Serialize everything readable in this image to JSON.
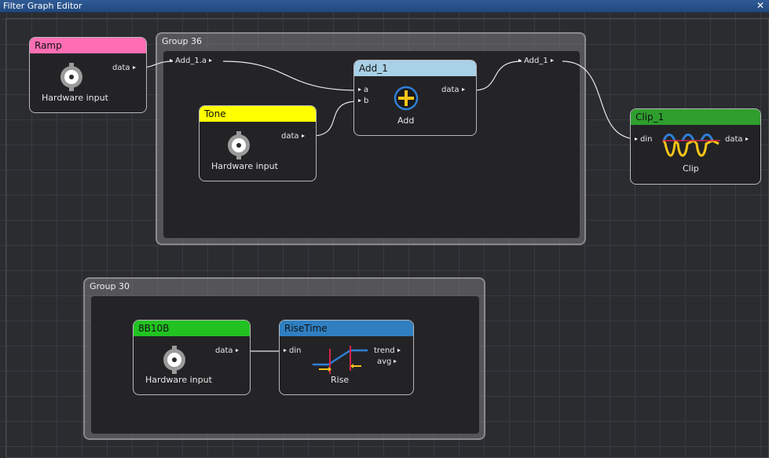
{
  "window": {
    "title": "Filter Graph Editor",
    "close_glyph": "✕"
  },
  "groups": [
    {
      "id": "g36",
      "label": "Group 36"
    },
    {
      "id": "g30",
      "label": "Group 30"
    }
  ],
  "group_pins": {
    "add1a": "Add_1.a",
    "add1": "Add_1"
  },
  "nodes": {
    "ramp": {
      "title": "Ramp",
      "caption": "Hardware input",
      "out": "data",
      "color": "#ff6eb4"
    },
    "tone": {
      "title": "Tone",
      "caption": "Hardware input",
      "out": "data",
      "color": "#ffff00"
    },
    "add": {
      "title": "Add_1",
      "caption": "Add",
      "in_a": "a",
      "in_b": "b",
      "out": "data",
      "color": "#a8d0e6"
    },
    "clip": {
      "title": "Clip_1",
      "caption": "Clip",
      "in": "din",
      "out": "data",
      "color": "#2e9e2e"
    },
    "b8b10b": {
      "title": "8B10B",
      "caption": "Hardware input",
      "out": "data",
      "color": "#22c222"
    },
    "risetime": {
      "title": "RiseTime",
      "caption": "Rise",
      "in": "din",
      "out1": "trend",
      "out2": "avg",
      "color": "#2f7fc1"
    }
  },
  "icons": {
    "hardware": "bnc-connector-icon",
    "add": "plus-circle-icon",
    "clip": "clipped-sine-icon",
    "rise": "rise-time-icon"
  }
}
